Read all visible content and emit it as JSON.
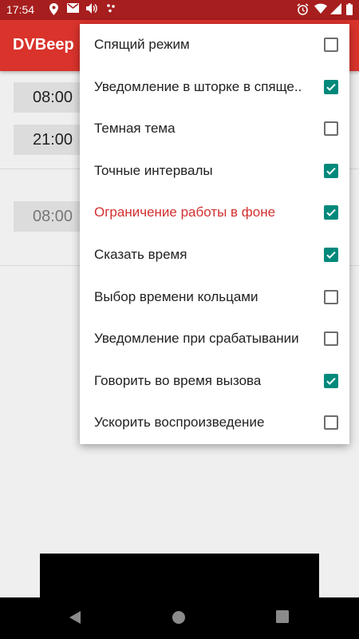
{
  "status_bar": {
    "time": "17:54"
  },
  "app_bar": {
    "title": "DVBeep"
  },
  "background": {
    "times": [
      "08:00",
      "21:00",
      "08:00"
    ]
  },
  "menu": {
    "items": [
      {
        "label": "Спящий режим",
        "checked": false,
        "warn": false
      },
      {
        "label": "Уведомление в шторке в спяще..",
        "checked": true,
        "warn": false
      },
      {
        "label": "Темная тема",
        "checked": false,
        "warn": false
      },
      {
        "label": "Точные интервалы",
        "checked": true,
        "warn": false
      },
      {
        "label": "Ограничение работы в фоне",
        "checked": true,
        "warn": true
      },
      {
        "label": "Сказать время",
        "checked": true,
        "warn": false
      },
      {
        "label": "Выбор времени кольцами",
        "checked": false,
        "warn": false
      },
      {
        "label": "Уведомление при срабатывании",
        "checked": false,
        "warn": false
      },
      {
        "label": "Говорить во время вызова",
        "checked": true,
        "warn": false
      },
      {
        "label": "Ускорить воспроизведение",
        "checked": false,
        "warn": false
      }
    ]
  },
  "colors": {
    "status_bar": "#a71e1e",
    "app_bar": "#d9332c",
    "checkbox_checked": "#00897b",
    "warn_text": "#d32f2f"
  }
}
